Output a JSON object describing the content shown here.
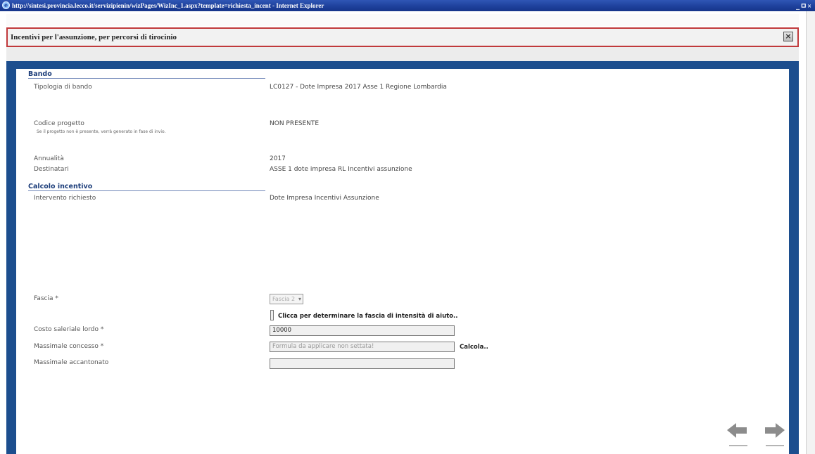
{
  "window": {
    "title": "http://sintesi.provincia.lecco.it/servizipienin/wizPages/WizInc_1.aspx?template=richiesta_incent - Internet Explorer",
    "controls": "_ㅁ×"
  },
  "dialog": {
    "title": "Incentivi per l'assunzione, per percorsi di tirocinio",
    "close_icon": "close-icon"
  },
  "sections": {
    "bando": "Bando",
    "calcolo": "Calcolo incentivo"
  },
  "fields": {
    "tipologia_label": "Tipologia di bando",
    "tipologia_value": "LC0127 - Dote Impresa 2017 Asse 1 Regione Lombardia",
    "codice_label": "Codice progetto",
    "codice_note": "Se il progetto non è presente, verrà generato in fase di invio.",
    "codice_value": "NON PRESENTE",
    "annualita_label": "Annualità",
    "annualita_value": "2017",
    "destinatari_label": "Destinatari",
    "destinatari_value": "ASSE 1 dote impresa RL Incentivi assunzione",
    "intervento_label": "Intervento richiesto",
    "intervento_value": "Dote Impresa Incentivi Assunzione",
    "fascia_label": "Fascia *",
    "fascia_selected": "Fascia 2",
    "clicca_text": "Clicca per determinare la fascia di intensità di aiuto..",
    "costo_label": "Costo saleriale lordo *",
    "costo_value": "10000",
    "massimale_label": "Massimale concesso *",
    "massimale_placeholder": "Formula da applicare non settata!",
    "calcola_label": "Calcola..",
    "accantonato_label": "Massimale accantonato",
    "accantonato_value": ""
  },
  "nav": {
    "back_icon": "arrow-left-icon",
    "next_icon": "arrow-right-icon"
  },
  "colors": {
    "frame": "#1c4e8e",
    "titlebar": "#1d3f9a",
    "header_border": "#c0393b",
    "section": "#1c3d7a"
  }
}
